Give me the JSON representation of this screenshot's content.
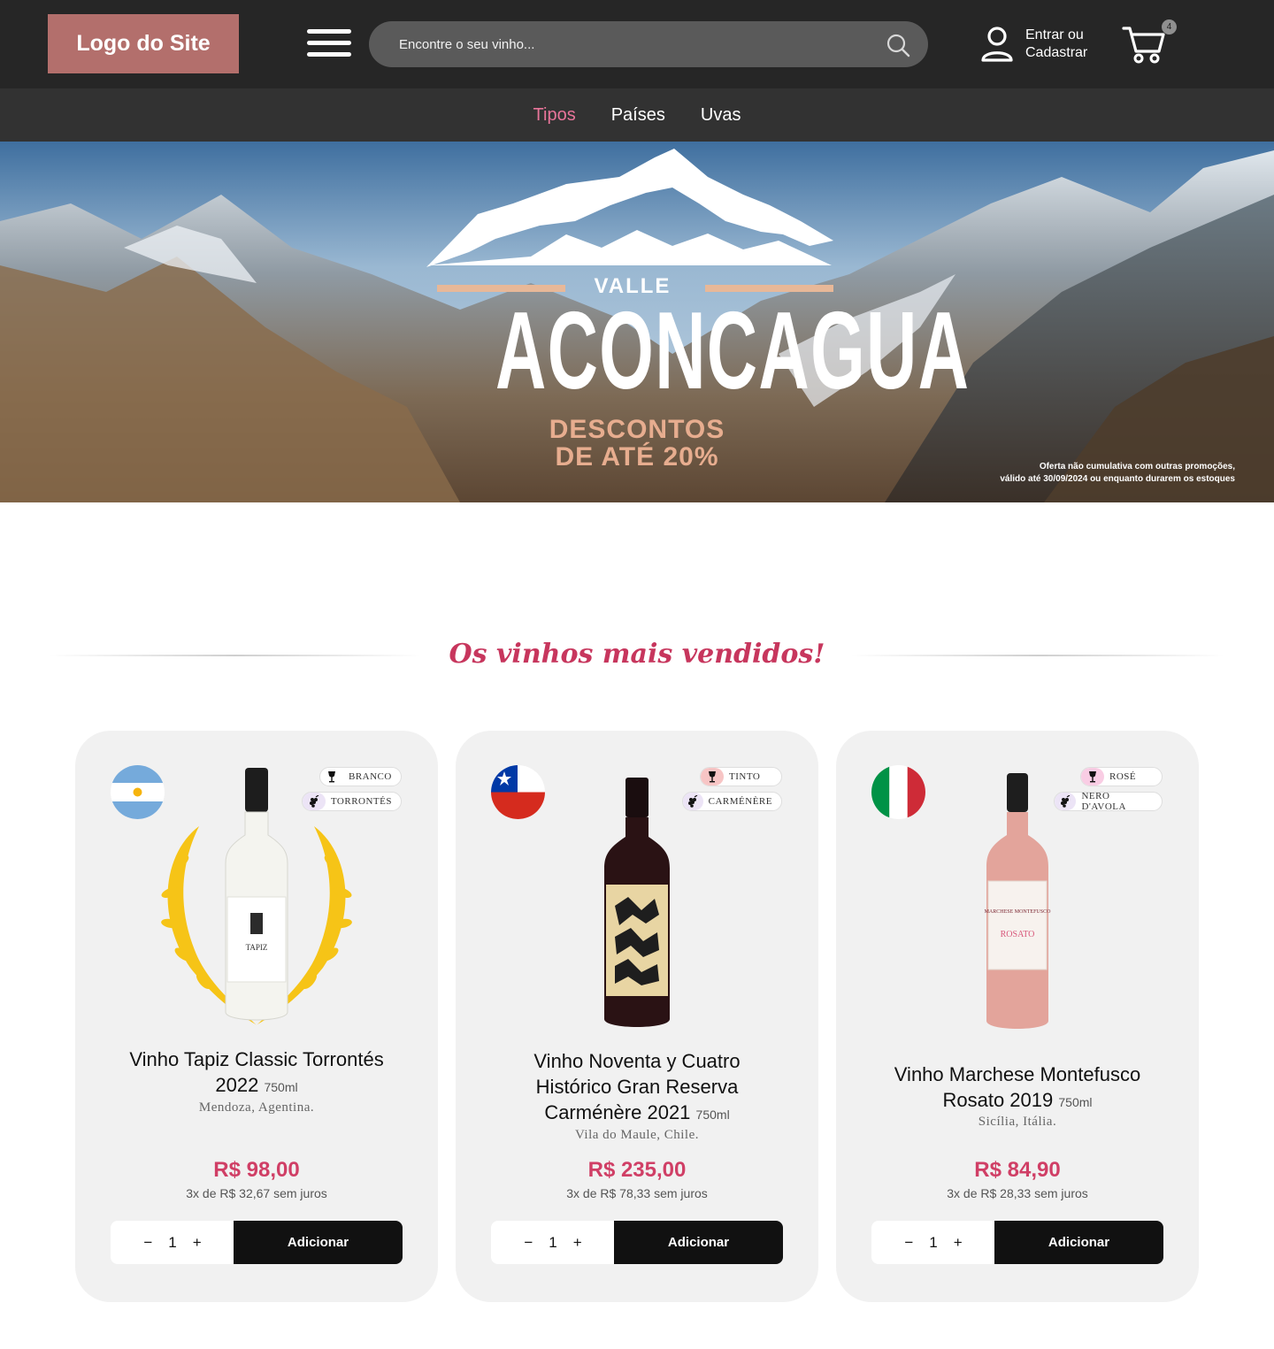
{
  "header": {
    "logo": "Logo do Site",
    "search_placeholder": "Encontre o seu vinho...",
    "user_line1": "Entrar ou",
    "user_line2": "Cadastrar",
    "cart_count": "4"
  },
  "nav": {
    "items": [
      {
        "label": "Tipos",
        "active": true
      },
      {
        "label": "Países",
        "active": false
      },
      {
        "label": "Uvas",
        "active": false
      }
    ],
    "active_color": "#e8759a"
  },
  "banner": {
    "kicker": "VALLE",
    "title": "ACONCAGUA",
    "discount_line1": "DESCONTOS",
    "discount_line2": "DE ATÉ 20%",
    "fine_line1": "Oferta não cumulativa com outras promoções,",
    "fine_line2": "válido até 30/09/2024 ou enquanto durarem os estoques"
  },
  "section": {
    "title": "Os vinhos mais vendidos!"
  },
  "products": [
    {
      "name_line1": "Vinho Tapiz Classic Torrontés",
      "name_line2": "2022",
      "volume": "750ml",
      "origin": "Mendoza, Agentina.",
      "price": "R$ 98,00",
      "installments": "3x de R$ 32,67 sem juros",
      "type_tag": "BRANCO",
      "grape_tag": "TORRONTÉS",
      "quantity": "1",
      "button": "Adicionar",
      "flag": "argentina",
      "bottle_label_text": "TAPIZ"
    },
    {
      "name_line1": "Vinho Noventa y Cuatro",
      "name_line2": "Histórico Gran Reserva",
      "name_line3": "Carménère 2021",
      "volume": "750ml",
      "origin": "Vila do Maule, Chile.",
      "price": "R$ 235,00",
      "installments": "3x de R$ 78,33 sem juros",
      "type_tag": "TINTO",
      "grape_tag": "CARMÉNÈRE",
      "quantity": "1",
      "button": "Adicionar",
      "flag": "chile"
    },
    {
      "name_line1": "Vinho Marchese Montefusco",
      "name_line2": "Rosato 2019",
      "volume": "750ml",
      "origin": "Sicília, Itália.",
      "price": "R$ 84,90",
      "installments": "3x de R$ 28,33 sem juros",
      "type_tag": "ROSÉ",
      "grape_tag": "NERO D'AVOLA",
      "quantity": "1",
      "button": "Adicionar",
      "flag": "italy",
      "bottle_label_text": "MARCHESE MONTEFUSCO",
      "bottle_label_sub": "ROSATO"
    }
  ],
  "icons": {
    "search": "search-icon",
    "user": "user-icon",
    "cart": "cart-icon",
    "menu": "hamburger-icon",
    "wine_glass": "wine-glass-icon",
    "grapes": "grapes-icon",
    "laurel": "laurel-wreath-icon"
  },
  "colors": {
    "header_bg": "#262626",
    "nav_bg": "#323232",
    "logo_bg": "#b36f6c",
    "accent": "#d03f66",
    "card_bg": "#f1f1f1",
    "button_bg": "#111111"
  }
}
